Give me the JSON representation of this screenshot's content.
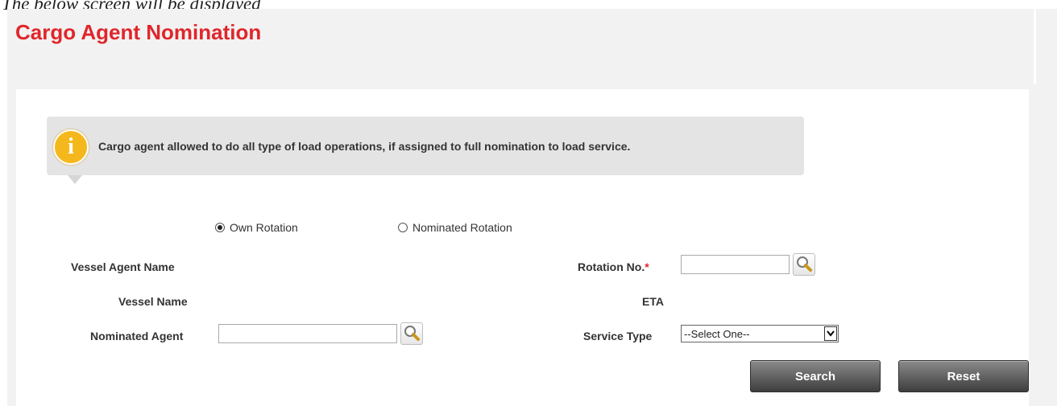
{
  "caption": "The below screen will be displayed",
  "page": {
    "title": "Cargo Agent Nomination"
  },
  "info": {
    "message": "Cargo agent allowed to do all type of load operations, if assigned to full nomination to load service."
  },
  "rotation_type": {
    "options": [
      {
        "label": "Own Rotation",
        "selected": true
      },
      {
        "label": "Nominated Rotation",
        "selected": false
      }
    ]
  },
  "form": {
    "vessel_agent_name_label": "Vessel Agent Name",
    "vessel_name_label": "Vessel Name",
    "nominated_agent_label": "Nominated Agent",
    "nominated_agent_value": "",
    "rotation_no_label": "Rotation No.",
    "rotation_no_required": "*",
    "rotation_no_value": "",
    "eta_label": "ETA",
    "service_type_label": "Service Type",
    "service_type_selected": "--Select One--"
  },
  "actions": {
    "search_label": "Search",
    "reset_label": "Reset"
  },
  "colors": {
    "title": "#e0262b",
    "info_icon": "#f5b81c",
    "button": "#5a5a5a"
  },
  "icons": {
    "info": "info-icon",
    "lookup": "magnifier-icon",
    "dropdown": "chevron-down-icon"
  }
}
